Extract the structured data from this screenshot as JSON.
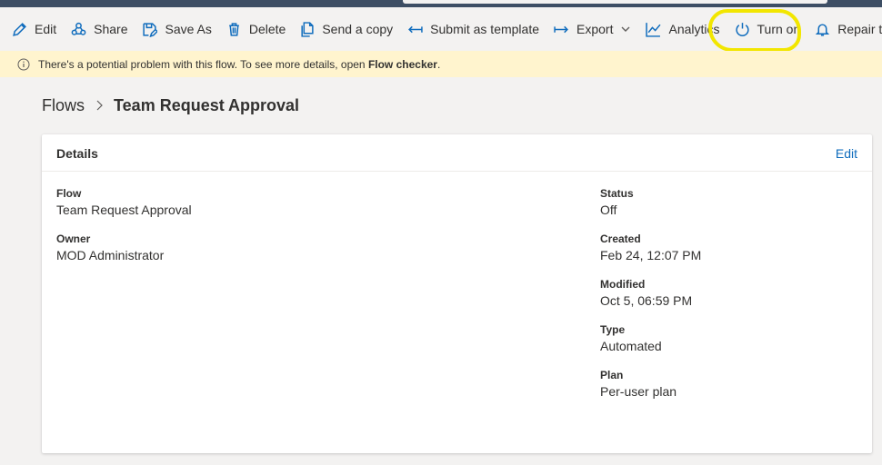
{
  "toolbar": {
    "edit": "Edit",
    "share": "Share",
    "save_as": "Save As",
    "delete": "Delete",
    "send_copy": "Send a copy",
    "submit_template": "Submit as template",
    "export": "Export",
    "analytics": "Analytics",
    "turn_on": "Turn on",
    "repair_tips": "Repair tips"
  },
  "warning": {
    "text": "There's a potential problem with this flow. To see more details, open ",
    "link": "Flow checker",
    "suffix": "."
  },
  "breadcrumb": {
    "root": "Flows",
    "current": "Team Request Approval"
  },
  "details": {
    "title": "Details",
    "edit_label": "Edit",
    "flow_label": "Flow",
    "flow_value": "Team Request Approval",
    "owner_label": "Owner",
    "owner_value": "MOD Administrator",
    "status_label": "Status",
    "status_value": "Off",
    "created_label": "Created",
    "created_value": "Feb 24, 12:07 PM",
    "modified_label": "Modified",
    "modified_value": "Oct 5, 06:59 PM",
    "type_label": "Type",
    "type_value": "Automated",
    "plan_label": "Plan",
    "plan_value": "Per-user plan"
  },
  "colors": {
    "accent": "#0f6cbd",
    "warning_bg": "#fff4ce",
    "highlight": "#f2e600",
    "topbar": "#3d4e64"
  }
}
